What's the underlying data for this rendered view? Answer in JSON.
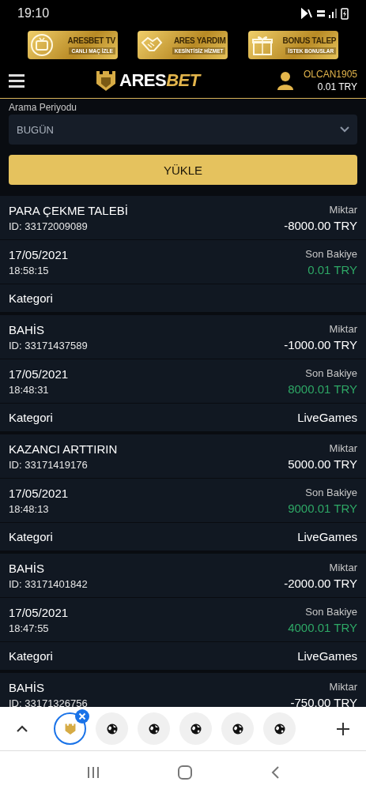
{
  "status_bar": {
    "time": "19:10"
  },
  "banners": [
    {
      "kind": "tv",
      "title": "ARESBET TV",
      "subtitle": "CANLI MAÇ İZLE"
    },
    {
      "kind": "help",
      "title": "ARES YARDIM",
      "subtitle": "KESİNTİSİZ HİZMET"
    },
    {
      "kind": "gift",
      "title": "BONUS TALEP",
      "subtitle": "İSTEK BONUSLAR"
    }
  ],
  "header": {
    "logo_main": "ARES",
    "logo_accent": "BET",
    "username": "OLCAN1905",
    "balance": "0.01 TRY"
  },
  "filter": {
    "label": "Arama Periyodu",
    "value": "BUGÜN",
    "button": "YÜKLE"
  },
  "transactions": [
    {
      "type": "PARA ÇEKME TALEBİ",
      "id": "ID: 33172009089",
      "amount_label": "Miktar",
      "amount": "-8000.00 TRY",
      "date": "17/05/2021",
      "time": "18:58:15",
      "balance_label": "Son Bakiye",
      "balance": "0.01 TRY",
      "category_label": "Kategori"
    },
    {
      "type": "BAHİS",
      "id": "ID: 33171437589",
      "amount_label": "Miktar",
      "amount": "-1000.00 TRY",
      "date": "17/05/2021",
      "time": "18:48:31",
      "balance_label": "Son Bakiye",
      "balance": "8000.01 TRY",
      "category_label": "Kategori",
      "category": "LiveGames"
    },
    {
      "type": "KAZANCI ARTTIRIN",
      "id": "ID: 33171419176",
      "amount_label": "Miktar",
      "amount": "5000.00 TRY",
      "date": "17/05/2021",
      "time": "18:48:13",
      "balance_label": "Son Bakiye",
      "balance": "9000.01 TRY",
      "category_label": "Kategori",
      "category": "LiveGames"
    },
    {
      "type": "BAHİS",
      "id": "ID: 33171401842",
      "amount_label": "Miktar",
      "amount": "-2000.00 TRY",
      "date": "17/05/2021",
      "time": "18:47:55",
      "balance_label": "Son Bakiye",
      "balance": "4000.01 TRY",
      "category_label": "Kategori",
      "category": "LiveGames"
    },
    {
      "type": "BAHİS",
      "id": "ID: 33171326756",
      "amount_label": "Miktar",
      "amount": "-750.00 TRY"
    }
  ],
  "browser_tabs": [
    {
      "kind": "site",
      "selected": true
    },
    {
      "kind": "globe",
      "selected": false
    },
    {
      "kind": "globe",
      "selected": false
    },
    {
      "kind": "globe",
      "selected": false
    },
    {
      "kind": "globe",
      "selected": false
    },
    {
      "kind": "globe",
      "selected": false
    }
  ]
}
